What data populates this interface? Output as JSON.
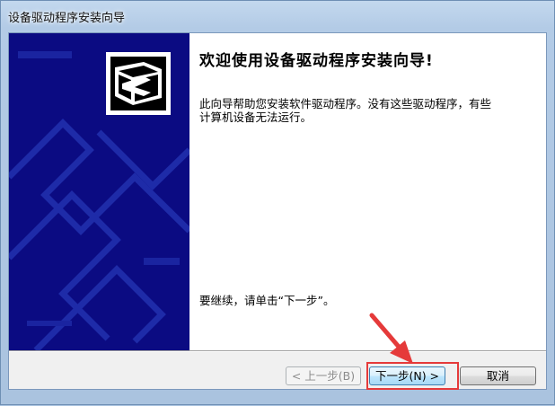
{
  "window": {
    "title": "设备驱动程序安装向导"
  },
  "wizard": {
    "heading": "欢迎使用设备驱动程序安装向导!",
    "description": "此向导帮助您安装软件驱动程序。没有这些驱动程序，有些计算机设备无法运行。",
    "continue_text": "要继续，请单击“下一步”。"
  },
  "buttons": {
    "back": "< 上一步(B)",
    "next": "下一步(N) >",
    "cancel": "取消"
  },
  "icons": {
    "banner": "device-box-icon",
    "annotation": "red-arrow-icon"
  },
  "colors": {
    "banner_bg": "#0b0b82",
    "highlight": "#e53a3a"
  }
}
